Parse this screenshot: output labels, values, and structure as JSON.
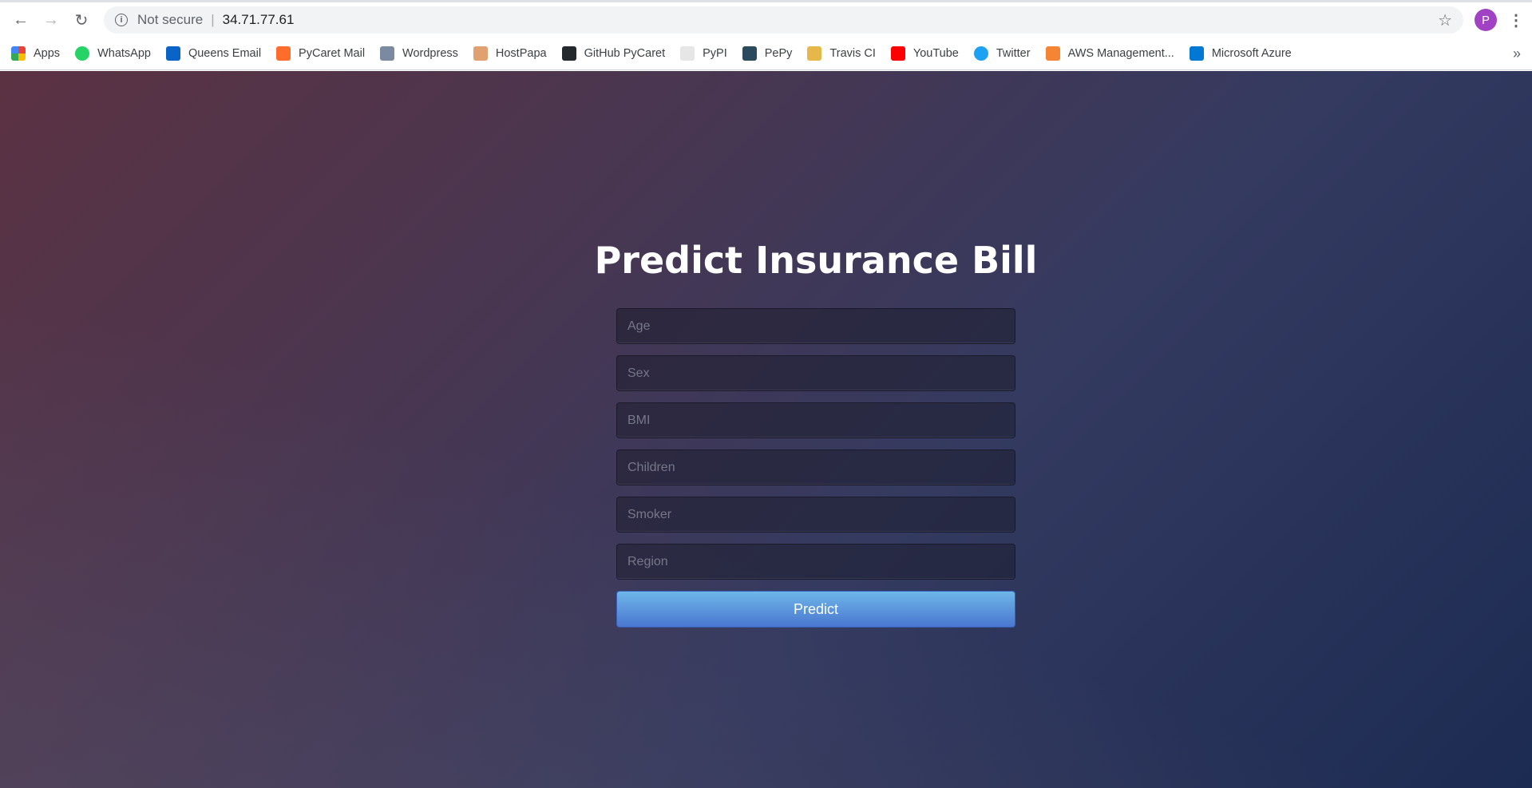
{
  "browser": {
    "security_label": "Not secure",
    "url": "34.71.77.61",
    "profile_initial": "P"
  },
  "bookmarks": [
    {
      "label": "Apps",
      "icon": "apps-grid-icon",
      "color": "#ea4335"
    },
    {
      "label": "WhatsApp",
      "icon": "whatsapp-icon",
      "color": "#25d366"
    },
    {
      "label": "Queens Email",
      "icon": "outlook-icon",
      "color": "#0a64c8"
    },
    {
      "label": "PyCaret Mail",
      "icon": "cpanel-icon",
      "color": "#ff6c2c"
    },
    {
      "label": "Wordpress",
      "icon": "wordpress-icon",
      "color": "#7b8aa0"
    },
    {
      "label": "HostPapa",
      "icon": "hostpapa-icon",
      "color": "#e0a070"
    },
    {
      "label": "GitHub PyCaret",
      "icon": "github-icon",
      "color": "#24292e"
    },
    {
      "label": "PyPI",
      "icon": "pypi-icon",
      "color": "#e6e6e6"
    },
    {
      "label": "PePy",
      "icon": "pepy-icon",
      "color": "#2b4a5e"
    },
    {
      "label": "Travis CI",
      "icon": "travis-icon",
      "color": "#e6b84a"
    },
    {
      "label": "YouTube",
      "icon": "youtube-icon",
      "color": "#ff0000"
    },
    {
      "label": "Twitter",
      "icon": "twitter-icon",
      "color": "#1da1f2"
    },
    {
      "label": "AWS Management...",
      "icon": "aws-icon",
      "color": "#f58534"
    },
    {
      "label": "Microsoft Azure",
      "icon": "azure-icon",
      "color": "#0078d4"
    }
  ],
  "form": {
    "title": "Predict Insurance Bill",
    "fields": [
      {
        "name": "age",
        "placeholder": "Age"
      },
      {
        "name": "sex",
        "placeholder": "Sex"
      },
      {
        "name": "bmi",
        "placeholder": "BMI"
      },
      {
        "name": "children",
        "placeholder": "Children"
      },
      {
        "name": "smoker",
        "placeholder": "Smoker"
      },
      {
        "name": "region",
        "placeholder": "Region"
      }
    ],
    "submit_label": "Predict"
  }
}
